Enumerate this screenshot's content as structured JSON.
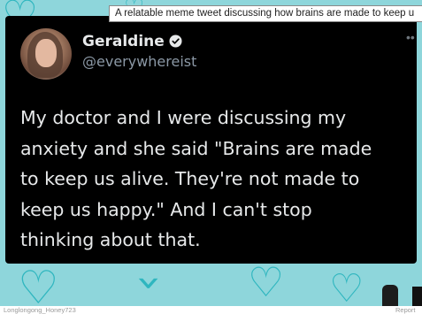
{
  "tooltip": {
    "text": "A relatable meme tweet discussing how brains are made to keep u"
  },
  "tweet": {
    "display_name": "Geraldine",
    "handle": "@everywhereist",
    "text": "My doctor and I were discussing my\nanxiety and she said \"Brains are made\nto keep us alive. They're not made to\nkeep us happy.\" And I can't stop\nthinking about that.",
    "verified_icon": "verified-badge-icon",
    "more_icon": "more-icon"
  },
  "footer": {
    "credit": "Longlongong_Honey723",
    "report": "Report"
  },
  "colors": {
    "background_teal": "#8ed6db",
    "heart_teal": "#2fb6bf",
    "tweet_bg": "#000000",
    "text_primary": "#e7e9ea",
    "text_secondary": "#8b98a5"
  }
}
